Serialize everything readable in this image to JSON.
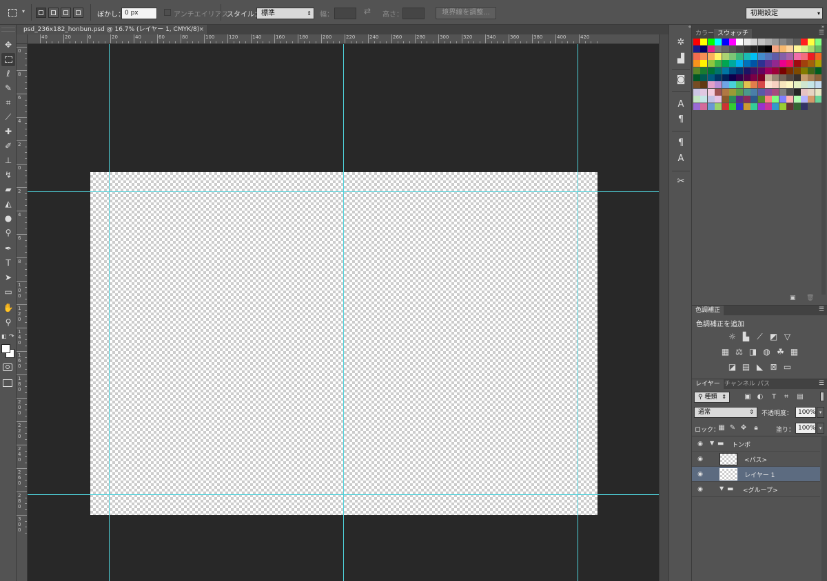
{
  "options_bar": {
    "feather_label": "ぼかし：",
    "feather_value": "0 px",
    "antialias_label": "アンチエイリアス",
    "style_label": "スタイル：",
    "style_value": "標準",
    "width_label": "幅：",
    "height_label": "高さ：",
    "refine_edge_label": "境界線を調整...",
    "workspace_value": "初期設定"
  },
  "document": {
    "tab_title": "psd_236x182_honbun.psd @ 16.7% (レイヤー 1, CMYK/8)",
    "close_glyph": "×"
  },
  "rulers": {
    "horizontal_labels": [
      "40",
      "20",
      "0",
      "20",
      "40",
      "60",
      "80",
      "100",
      "120",
      "140",
      "160",
      "180",
      "200",
      "220",
      "240",
      "260",
      "280",
      "300",
      "320",
      "340",
      "360",
      "380",
      "400",
      "420"
    ],
    "vertical_labels": [
      "0",
      "8",
      "6",
      "4",
      "2",
      "0",
      "2",
      "4",
      "6",
      "8",
      "100",
      "120",
      "140",
      "160",
      "180",
      "200",
      "220",
      "240",
      "260",
      "280",
      "300"
    ]
  },
  "panels": {
    "color_tab": "カラー",
    "swatches_tab": "スウォッチ",
    "adjustments_tab": "色調補正",
    "adjustments_title": "色調補正を追加",
    "layers_tab": "レイヤー",
    "channels_tab": "チャンネル",
    "paths_tab": "パス",
    "filter_kind": "種類",
    "blend_mode": "通常",
    "opacity_label": "不透明度：",
    "opacity_value": "100%",
    "lock_label": "ロック：",
    "fill_label": "塗り：",
    "fill_value": "100%"
  },
  "layers": [
    {
      "name": "トンボ",
      "kind": "group",
      "expanded": true
    },
    {
      "name": "<パス>",
      "kind": "layer"
    },
    {
      "name": "レイヤー 1",
      "kind": "layer",
      "active": true
    },
    {
      "name": "<グループ>",
      "kind": "group",
      "expanded": true
    }
  ],
  "swatch_colors": [
    "#ff0000",
    "#ffff00",
    "#00ff00",
    "#00ffff",
    "#0000ff",
    "#ff00ff",
    "#ffffff",
    "#ebebeb",
    "#d6d6d6",
    "#c2c2c2",
    "#adadad",
    "#999999",
    "#858585",
    "#707070",
    "#5c5c5c",
    "#ff2020",
    "#ffff40",
    "#80ff80",
    "#1a1a8c",
    "#000066",
    "#e0218a",
    "#7a7a7a",
    "#666666",
    "#555555",
    "#444444",
    "#333333",
    "#222222",
    "#111111",
    "#000000",
    "#f4a582",
    "#f7b86e",
    "#fdd49e",
    "#fff799",
    "#d9ef8b",
    "#a6d96a",
    "#66bd63",
    "#f26c4f",
    "#f68e55",
    "#fbaf5c",
    "#fff467",
    "#acd372",
    "#7cc576",
    "#3bb878",
    "#1abbb4",
    "#00bff3",
    "#438ccb",
    "#5574b9",
    "#605ca8",
    "#855fa8",
    "#a763a8",
    "#f06ea9",
    "#f26d7d",
    "#ed1c24",
    "#f26522",
    "#f7941d",
    "#fff200",
    "#8dc63f",
    "#39b54a",
    "#00a651",
    "#00a99d",
    "#00aeef",
    "#0072bc",
    "#0054a6",
    "#2e3192",
    "#662d91",
    "#92278f",
    "#ec008c",
    "#ed145b",
    "#9e0b0f",
    "#a0410d",
    "#a3620a",
    "#aba000",
    "#598527",
    "#1a7b30",
    "#007236",
    "#00746b",
    "#0076a3",
    "#004b80",
    "#003471",
    "#1b1464",
    "#440e62",
    "#630460",
    "#9e005d",
    "#9e0039",
    "#790000",
    "#7b2e00",
    "#7d4900",
    "#827b00",
    "#406618",
    "#005e20",
    "#005826",
    "#005952",
    "#005b7f",
    "#003663",
    "#002157",
    "#0d004c",
    "#32004b",
    "#4b0049",
    "#7b0046",
    "#7a0026",
    "#c7b299",
    "#998675",
    "#736357",
    "#534741",
    "#37302d",
    "#c69c6d",
    "#a67c52",
    "#8c6239",
    "#754c24",
    "#603913",
    "#e2a0c8",
    "#b88ed6",
    "#6fa5e5",
    "#4ad0d8",
    "#55c46f",
    "#e0c24e",
    "#e27d4b",
    "#d64848",
    "#fbe2d0",
    "#f8d1c2",
    "#f7e5bd",
    "#fdf6c3",
    "#e5f2c4",
    "#cfe7cf",
    "#c5e6e7",
    "#c4dcf0",
    "#cdc6e4",
    "#e0c8e2",
    "#f3cde0",
    "#a05252",
    "#b07843",
    "#9b9b36",
    "#5e9e46",
    "#4a9a8c",
    "#4a7ea8",
    "#5a5aa8",
    "#8a4a9e",
    "#a84a7e",
    "#7f7f7f",
    "#4d4d4d",
    "#262626",
    "#e6c3c3",
    "#e6d4c3",
    "#e6e6c3",
    "#c3e6c3",
    "#c3e6e6",
    "#c3c3e6",
    "#e6c3e6",
    "#8b5a2b",
    "#2b8b5a",
    "#5a2b8b",
    "#8b2b5a",
    "#2b5a8b",
    "#5a8b2b",
    "#ff8080",
    "#80ff80",
    "#8080ff",
    "#ffb3b3",
    "#b3ffb3",
    "#b3b3ff",
    "#d49a6a",
    "#6ad49a",
    "#9a6ad4",
    "#d46a9a",
    "#6a9ad4",
    "#9ad46a",
    "#cc3333",
    "#33cc33",
    "#3333cc",
    "#cc9933",
    "#33cc99",
    "#9933cc",
    "#cc3399",
    "#3399cc",
    "#99cc33",
    "#663333",
    "#336633",
    "#333366"
  ]
}
